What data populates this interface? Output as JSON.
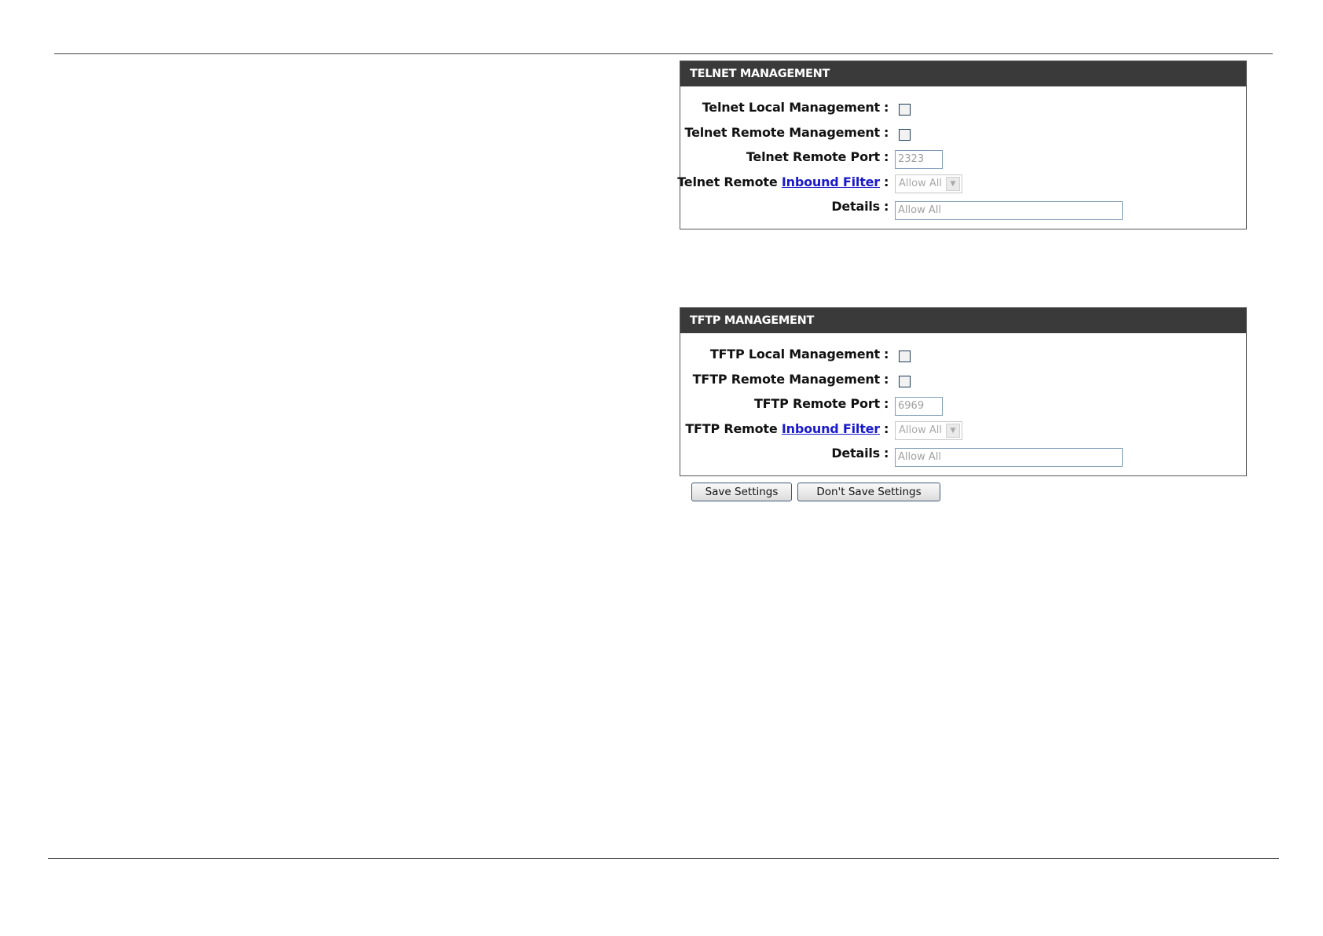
{
  "telnet": {
    "title": "TELNET MANAGEMENT",
    "local_label": "Telnet Local Management",
    "remote_label": "Telnet Remote Management",
    "port_label": "Telnet Remote Port",
    "port_value": "2323",
    "filter_label_prefix": "Telnet Remote",
    "filter_link": "Inbound Filter",
    "filter_selected": "Allow All",
    "details_label": "Details",
    "details_value": "Allow All"
  },
  "tftp": {
    "title": "TFTP MANAGEMENT",
    "local_label": "TFTP Local Management",
    "remote_label": "TFTP Remote Management",
    "port_label": "TFTP Remote Port",
    "port_value": "6969",
    "filter_label_prefix": "TFTP Remote",
    "filter_link": "Inbound Filter",
    "filter_selected": "Allow All",
    "details_label": "Details",
    "details_value": "Allow All"
  },
  "colon": ":",
  "buttons": {
    "save": "Save Settings",
    "dont_save": "Don't Save Settings"
  }
}
